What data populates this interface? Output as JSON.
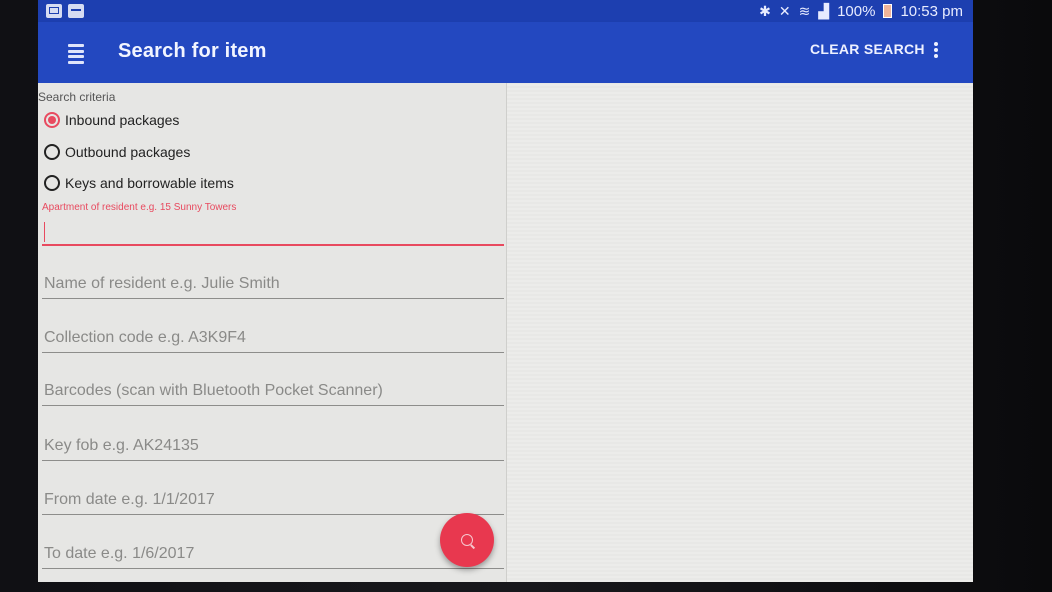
{
  "status_bar": {
    "battery": "100%",
    "time": "10:53 pm",
    "icons": [
      "mail-icon",
      "calendar-icon",
      "bluetooth-icon",
      "mute-icon",
      "wifi-icon",
      "signal-icon",
      "battery-icon"
    ]
  },
  "toolbar": {
    "title": "Search for item",
    "clear_search_label": "CLEAR SEARCH"
  },
  "search": {
    "section_label": "Search criteria",
    "radio_options": [
      {
        "label": "Inbound packages",
        "checked": true
      },
      {
        "label": "Outbound packages",
        "checked": false
      },
      {
        "label": "Keys and borrowable items",
        "checked": false
      }
    ],
    "fields": {
      "apartment": {
        "floating_label": "Apartment of resident e.g. 15 Sunny Towers",
        "value": ""
      },
      "resident_name": {
        "placeholder": "Name of resident e.g. Julie Smith"
      },
      "collection_code": {
        "placeholder": "Collection code e.g. A3K9F4"
      },
      "barcodes": {
        "placeholder": "Barcodes (scan with Bluetooth Pocket Scanner)"
      },
      "key_fob": {
        "placeholder": "Key fob e.g. AK24135"
      },
      "from_date": {
        "placeholder": "From date e.g. 1/1/2017"
      },
      "to_date": {
        "placeholder": "To date e.g. 1/6/2017"
      }
    }
  },
  "colors": {
    "primary": "#2348c0",
    "status_bar": "#1d3fb0",
    "accent": "#e84a5f",
    "fab": "#e8384f"
  }
}
